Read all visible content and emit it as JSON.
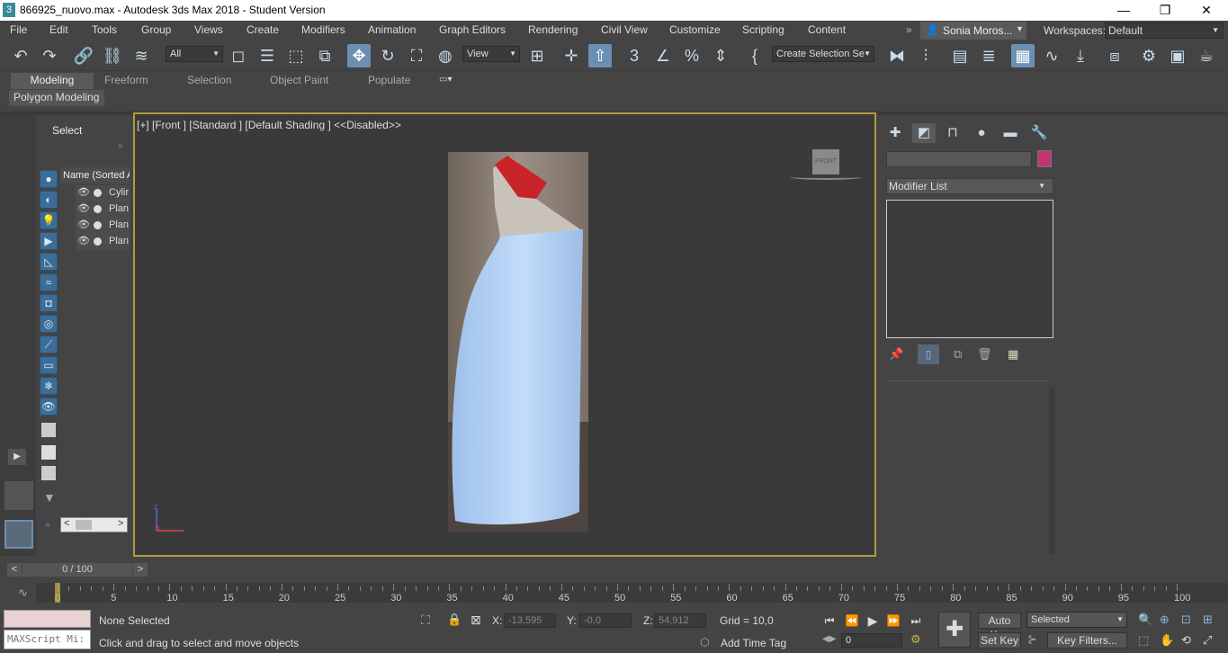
{
  "window": {
    "title": "866925_nuovo.max - Autodesk 3ds Max 2018 - Student Version",
    "minimize": "—",
    "maximize": "❐",
    "close": "✕"
  },
  "menu": [
    "File",
    "Edit",
    "Tools",
    "Group",
    "Views",
    "Create",
    "Modifiers",
    "Animation",
    "Graph Editors",
    "Rendering",
    "Civil View",
    "Customize",
    "Scripting",
    "Content"
  ],
  "user": {
    "name": "Sonia Moros..."
  },
  "workspace": {
    "label": "Workspaces:",
    "value": "Default"
  },
  "toolbar": {
    "filter": "All",
    "refcoord": "View",
    "selection_set": "Create Selection Se"
  },
  "ribbon": {
    "tabs": [
      "Modeling",
      "Freeform",
      "Selection",
      "Object Paint",
      "Populate"
    ],
    "panel": "Polygon Modeling"
  },
  "scene_explorer": {
    "title": "Select",
    "column": "Name (Sorted A",
    "items": [
      "Cylir",
      "Plan",
      "Plan",
      "Plan"
    ]
  },
  "viewport": {
    "label": "[+] [Front ] [Standard ] [Default Shading ]  <<Disabled>>",
    "viewcube": "FRONT",
    "axis_z": "z",
    "axis_x": "x"
  },
  "command_panel": {
    "modifier_list": "Modifier List",
    "color": "#c2336f"
  },
  "timeline": {
    "slider": "0 / 100",
    "ticks": [
      "0",
      "5",
      "10",
      "15",
      "20",
      "25",
      "30",
      "35",
      "40",
      "45",
      "50",
      "55",
      "60",
      "65",
      "70",
      "75",
      "80",
      "85",
      "90",
      "95",
      "100"
    ]
  },
  "status": {
    "selection": "None Selected",
    "prompt": "Click and drag to select and move objects",
    "maxscript": "MAXScript Mi:",
    "x_label": "X:",
    "x_value": "-13,595",
    "y_label": "Y:",
    "y_value": "-0,0",
    "z_label": "Z:",
    "z_value": "54,912",
    "grid": "Grid = 10,0",
    "add_time_tag": "Add Time Tag",
    "auto_key": "Auto Key",
    "set_key": "Set Key",
    "selected": "Selected",
    "key_filters": "Key Filters...",
    "frame": "0"
  }
}
